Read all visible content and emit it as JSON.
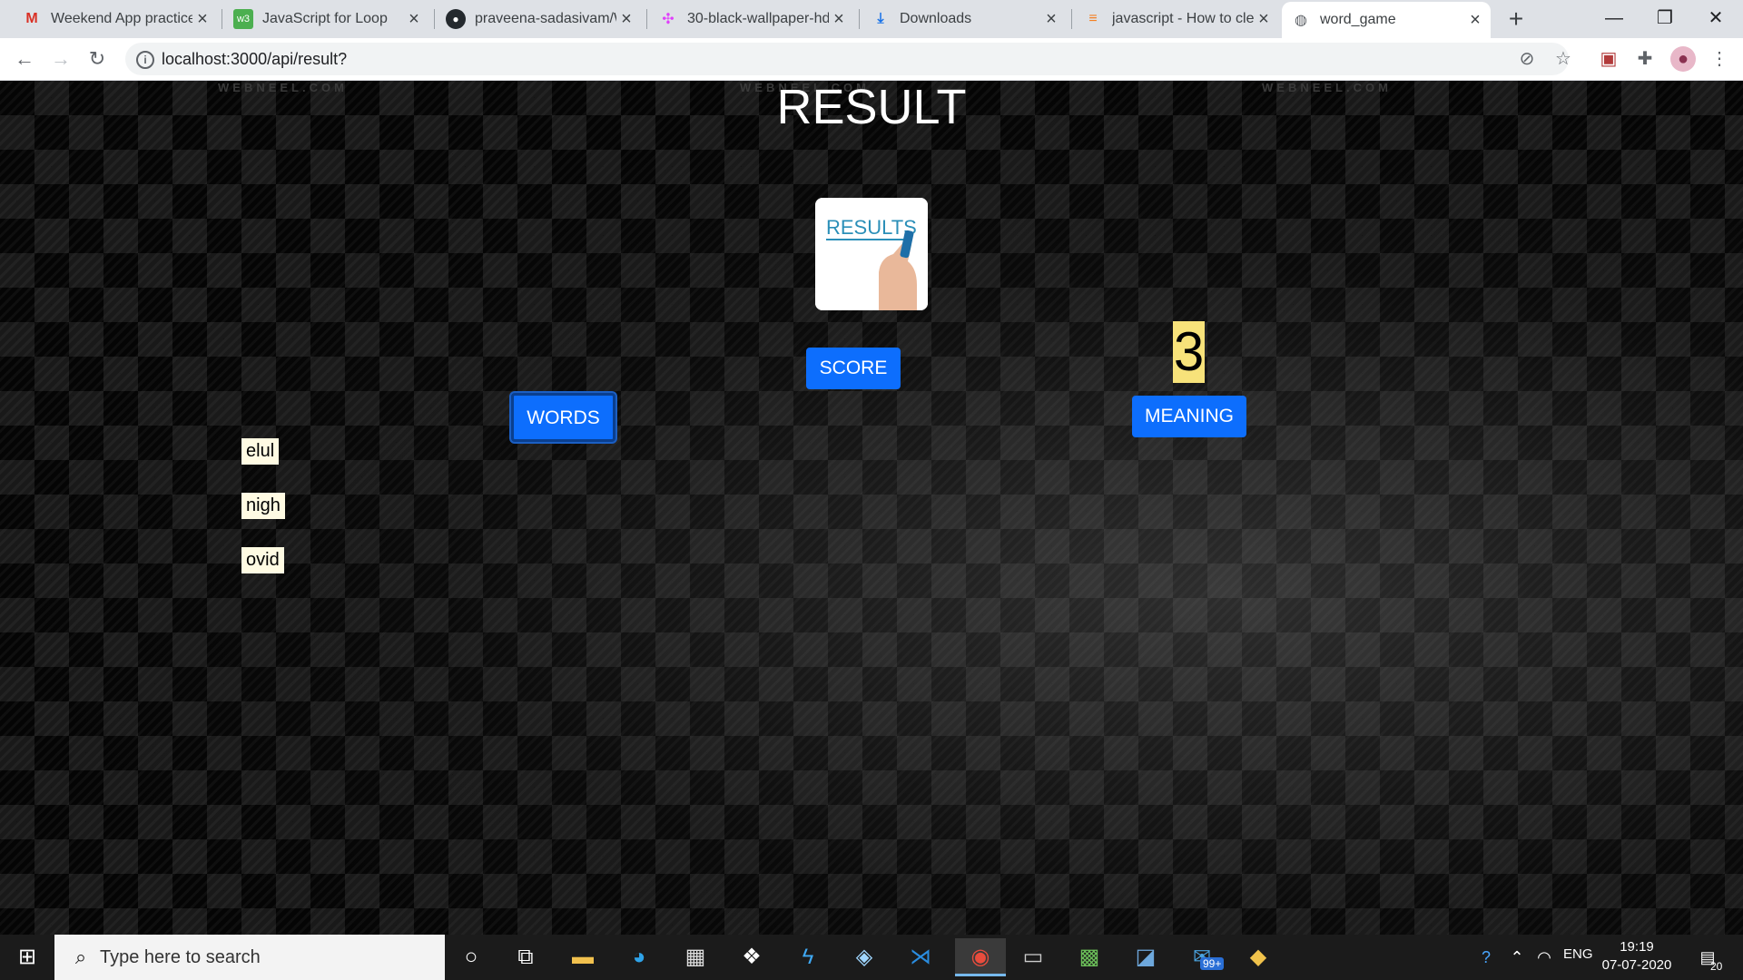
{
  "browser": {
    "tabs": [
      {
        "title": "Weekend App practice",
        "icon": "gmail-icon",
        "active": false
      },
      {
        "title": "JavaScript for Loop",
        "icon": "w3-icon",
        "active": false
      },
      {
        "title": "praveena-sadasivam/W",
        "icon": "github-icon",
        "active": false
      },
      {
        "title": "30-black-wallpaper-hd",
        "icon": "dots-icon",
        "active": false
      },
      {
        "title": "Downloads",
        "icon": "download-icon",
        "active": false
      },
      {
        "title": "javascript - How to clea",
        "icon": "stackoverflow-icon",
        "active": false
      },
      {
        "title": "word_game",
        "icon": "globe-icon",
        "active": true
      }
    ],
    "url": "localhost:3000/api/result?"
  },
  "page": {
    "watermarks": [
      "WEBNEEL.COM",
      "WEBNEEL.COM",
      "WEBNEEL.COM"
    ],
    "title": "RESULT",
    "image_text": "RESULTS",
    "score_label": "SCORE",
    "score_value": "3",
    "words_label": "WORDS",
    "meaning_label": "MEANING",
    "words": [
      "elul",
      "nigh",
      "ovid"
    ]
  },
  "taskbar": {
    "search_placeholder": "Type here to search",
    "mail_badge": "99+",
    "language": "ENG",
    "time": "19:19",
    "date": "07-07-2020",
    "notifications": "20"
  },
  "colors": {
    "accent_blue": "#0d6efd",
    "score_bg": "#f7e27a",
    "word_bg": "#fffbe3"
  }
}
